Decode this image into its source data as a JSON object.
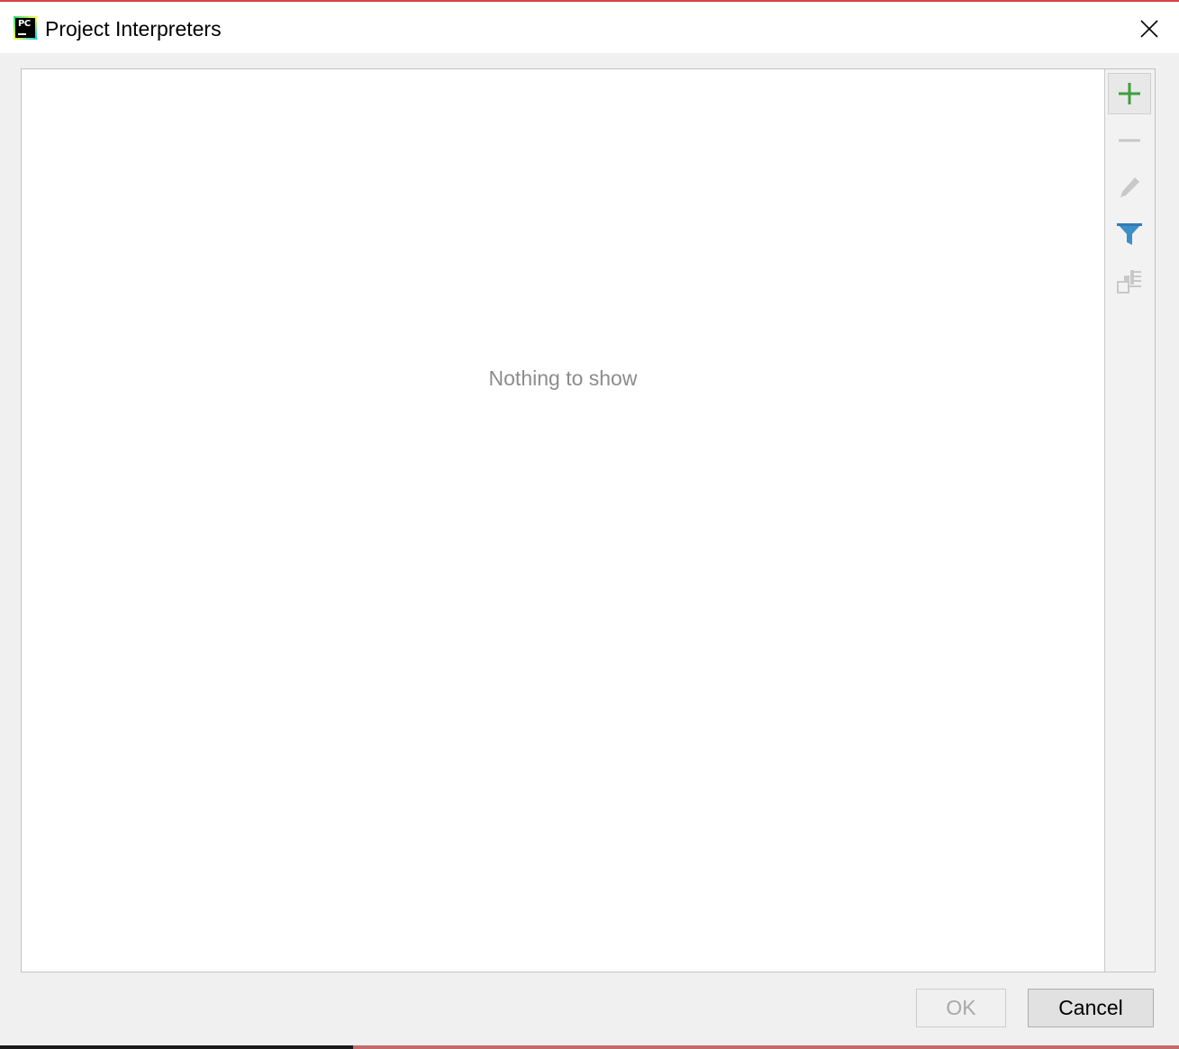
{
  "window": {
    "title": "Project Interpreters",
    "accent_color": "#d64545"
  },
  "app_icon": {
    "label": "PC",
    "name": "pycharm-icon"
  },
  "list": {
    "empty_text": "Nothing to show"
  },
  "toolbar": {
    "buttons": [
      {
        "name": "add-icon",
        "enabled": true,
        "color": "#3c9f3c"
      },
      {
        "name": "remove-icon",
        "enabled": false,
        "color": "#c8c8c8"
      },
      {
        "name": "edit-icon",
        "enabled": false,
        "color": "#c8c8c8"
      },
      {
        "name": "filter-icon",
        "enabled": true,
        "color": "#3d8fc7"
      },
      {
        "name": "show-paths-icon",
        "enabled": false,
        "color": "#c8c8c8"
      }
    ]
  },
  "footer": {
    "ok_label": "OK",
    "cancel_label": "Cancel"
  }
}
